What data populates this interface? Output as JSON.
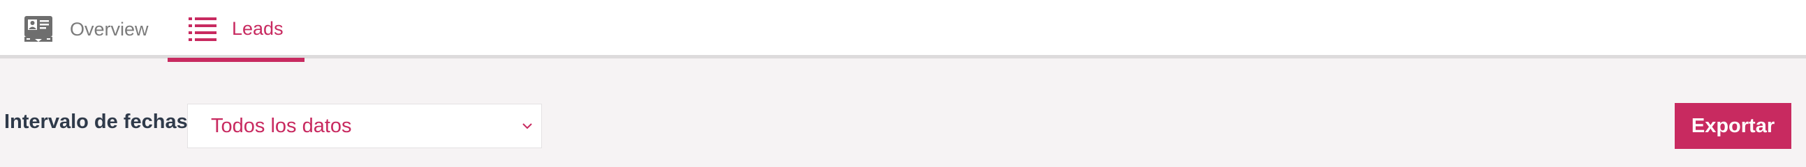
{
  "tabs": [
    {
      "label": "Overview",
      "icon": "contact-card-icon",
      "active": false
    },
    {
      "label": "Leads",
      "icon": "list-icon",
      "active": true
    }
  ],
  "filters": {
    "date_range_label": "Intervalo de fechas",
    "date_range_value": "Todos los datos",
    "export_label": "Exportar"
  },
  "colors": {
    "accent": "#c82a60",
    "inactive_text": "#7b7b7b",
    "label_text": "#2f3a4a",
    "background": "#f6f3f4"
  }
}
